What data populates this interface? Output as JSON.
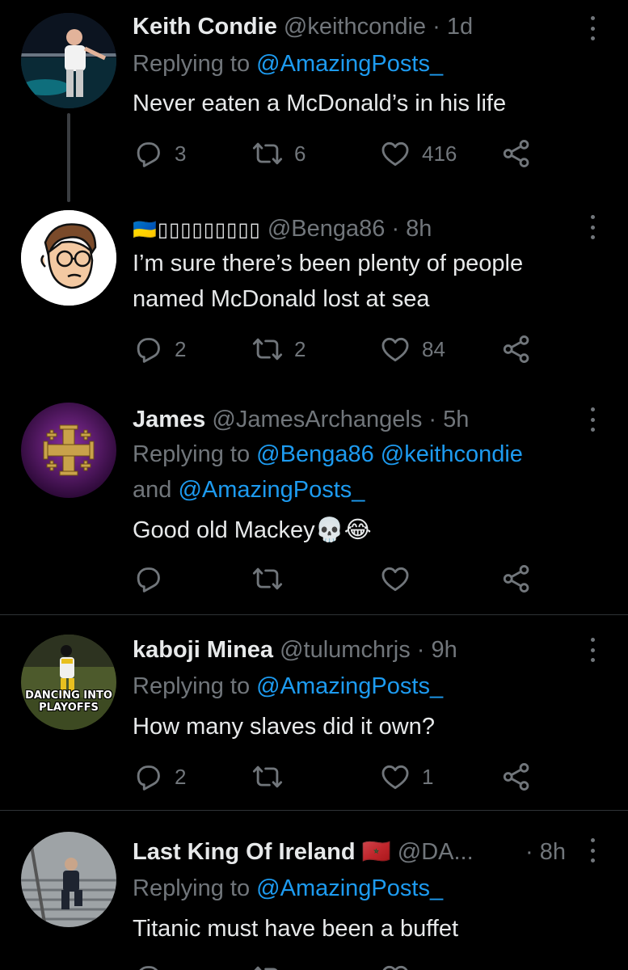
{
  "tweets": [
    {
      "name": "Keith Condie",
      "handle": "@keithcondie",
      "time": "· 1d",
      "reply_prefix": "Replying to ",
      "reply_mentions": "@AmazingPosts_",
      "body": [
        "Never eaten a McDonald’s in his life"
      ],
      "replies": "3",
      "retweets": "6",
      "likes": "416"
    },
    {
      "name": "🇺🇦▯▯▯▯▯▯▯▯▯",
      "handle": "@Benga86",
      "time": "· 8h",
      "body": [
        "I’m sure there’s been plenty of people",
        "named McDonald lost at sea"
      ],
      "replies": "2",
      "retweets": "2",
      "likes": "84"
    },
    {
      "name": "James",
      "handle": "@JamesArchangels",
      "time": "· 5h",
      "reply_prefix": "Replying to ",
      "reply_mentions": "@Benga86 @keithcondie",
      "reply_line2_prefix": "and ",
      "reply_line2_mention": "@AmazingPosts_",
      "body": [
        "Good old Mackey💀😂"
      ],
      "replies": "",
      "retweets": "",
      "likes": ""
    },
    {
      "name": "kaboji Minea",
      "handle": "@tulumchrjs",
      "time": "· 9h",
      "reply_prefix": "Replying to ",
      "reply_mentions": "@AmazingPosts_",
      "body": [
        "How many slaves did it own?"
      ],
      "avatar_text": [
        "DANCING INTO",
        "PLAYOFFS"
      ],
      "replies": "2",
      "retweets": "",
      "likes": "1"
    },
    {
      "name": "Last King Of Ireland",
      "flag": "🇲🇦",
      "handle": "@DA...",
      "time": "· 8h",
      "reply_prefix": "Replying to ",
      "reply_mentions": "@AmazingPosts_",
      "body": [
        "Titanic must have been a buffet"
      ]
    }
  ],
  "colors": {
    "background": "#000000",
    "text": "#e7e9ea",
    "muted": "#71767b",
    "accent": "#1d9bf0",
    "divider": "#2f3336"
  },
  "icons": [
    "reply-icon",
    "retweet-icon",
    "like-icon",
    "share-icon",
    "more-options-icon"
  ]
}
